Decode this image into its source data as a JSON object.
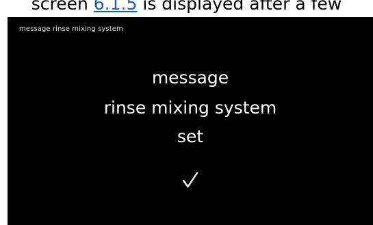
{
  "caption": {
    "before": "screen ",
    "link": "6.1.5",
    "after": " is displayed after a few"
  },
  "screen": {
    "title": "message rinse mixing system",
    "message_lines": [
      "message",
      "rinse mixing system",
      "set"
    ],
    "confirm_icon": "checkmark-icon",
    "colors": {
      "background": "#000000",
      "text": "#ffffff"
    }
  }
}
